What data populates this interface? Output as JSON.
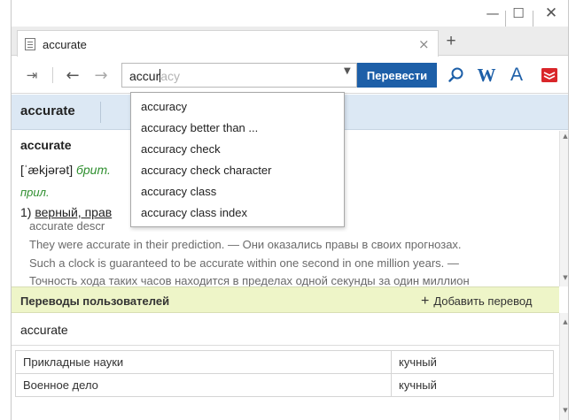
{
  "window": {
    "caption_buttons": {
      "minimize": "—",
      "maximize": "☐",
      "close": "✕"
    }
  },
  "tab": {
    "title": "accurate",
    "close_glyph": "×",
    "new_glyph": "+"
  },
  "toolbar": {
    "pin_glyph": "⇥",
    "back_glyph": "←",
    "forward_glyph": "→",
    "search_typed": "accur",
    "search_suggest": "acy",
    "translate_label": "Перевести",
    "wiki_label": "W",
    "font_label": "A"
  },
  "icons": {
    "pin": "pin-icon",
    "back": "back-arrow-icon",
    "forward": "forward-arrow-icon",
    "dropdown": "chevron-down-icon",
    "search": "search-icon",
    "wiki": "wikipedia-icon",
    "font": "font-icon",
    "book": "book-icon",
    "document": "document-icon",
    "plus": "plus-icon"
  },
  "colors": {
    "accent": "#1d5fa8",
    "header_bg": "#dce8f4",
    "user_bar_bg": "#eef5c8",
    "book_red": "#d9262a"
  },
  "word_header": {
    "tab_label": "accurate"
  },
  "entry": {
    "headword": "accurate",
    "transcription": "[ˈækjərət]",
    "region": "брит.",
    "pos": "прил.",
    "sense_number": "1)",
    "sense_text": "верный, прав",
    "examples": [
      "accurate descr",
      "They were accurate in their prediction. — Они оказались правы в своих прогнозах.",
      "Such a clock is guaranteed to be accurate within one second in one million years. —",
      "Точность хода таких часов находится в пределах одной секунды за один миллион"
    ]
  },
  "user_translations": {
    "title": "Переводы пользователей",
    "add_label": "Добавить перевод",
    "word": "accurate",
    "rows": [
      {
        "field": "Прикладные науки",
        "translation": "кучный"
      },
      {
        "field": "Военное дело",
        "translation": "кучный"
      }
    ]
  },
  "suggestions": [
    "accuracy",
    "accuracy better than ...",
    "accuracy check",
    "accuracy check character",
    "accuracy class",
    "accuracy class index"
  ]
}
